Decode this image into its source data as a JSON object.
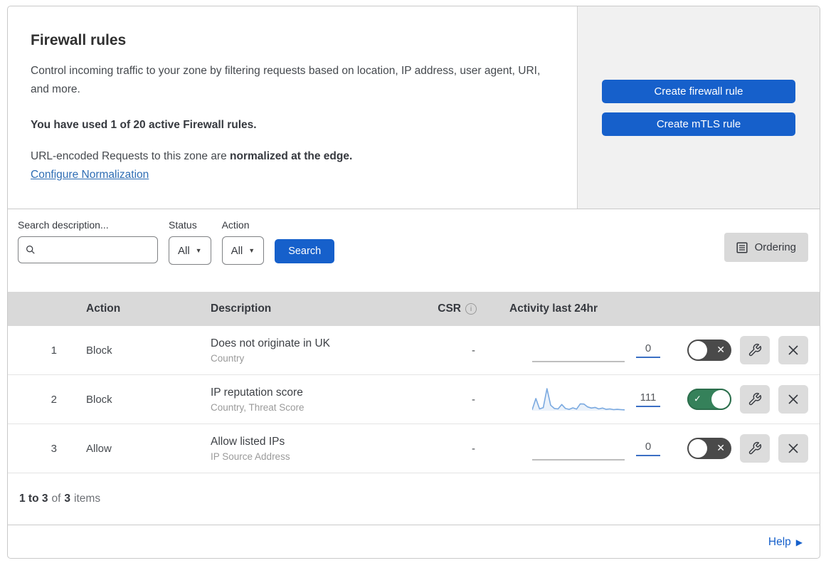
{
  "header": {
    "title": "Firewall rules",
    "description": "Control incoming traffic to your zone by filtering requests based on location, IP address, user agent, URI, and more.",
    "usage": "You have used 1 of 20 active Firewall rules.",
    "normalization_prefix": "URL-encoded Requests to this zone are ",
    "normalization_bold": "normalized at the edge.",
    "normalization_link": "Configure Normalization",
    "create_firewall_button": "Create firewall rule",
    "create_mtls_button": "Create mTLS rule"
  },
  "filters": {
    "search_label": "Search description...",
    "status_label": "Status",
    "status_value": "All",
    "action_label": "Action",
    "action_value": "All",
    "search_button": "Search",
    "ordering_button": "Ordering"
  },
  "table": {
    "columns": {
      "action": "Action",
      "description": "Description",
      "csr": "CSR",
      "activity": "Activity last 24hr"
    },
    "rows": [
      {
        "index": "1",
        "action": "Block",
        "description": "Does not originate in UK",
        "criteria": "Country",
        "csr": "-",
        "count": "0",
        "enabled": false,
        "sparkline": []
      },
      {
        "index": "2",
        "action": "Block",
        "description": "IP reputation score",
        "criteria": "Country, Threat Score",
        "csr": "-",
        "count": "111",
        "enabled": true,
        "sparkline": [
          4,
          55,
          8,
          14,
          100,
          25,
          10,
          8,
          28,
          10,
          6,
          13,
          7,
          31,
          30,
          17,
          12,
          15,
          8,
          12,
          6,
          8,
          5,
          6,
          5,
          4
        ]
      },
      {
        "index": "3",
        "action": "Allow",
        "description": "Allow listed IPs",
        "criteria": "IP Source Address",
        "csr": "-",
        "count": "0",
        "enabled": false,
        "sparkline": []
      }
    ]
  },
  "footer": {
    "range": "1 to 3",
    "of_text": "of",
    "total": "3",
    "items_text": "items",
    "help_link": "Help"
  },
  "colors": {
    "accent_blue": "#1660cb",
    "link_blue": "#2e6db4",
    "toggle_on_green": "#35815a",
    "toggle_off_gray": "#4a4a4a",
    "sparkline_blue": "#7aa9e0",
    "table_header_gray": "#d9d9d9",
    "panel_gray": "#f1f1f1"
  }
}
